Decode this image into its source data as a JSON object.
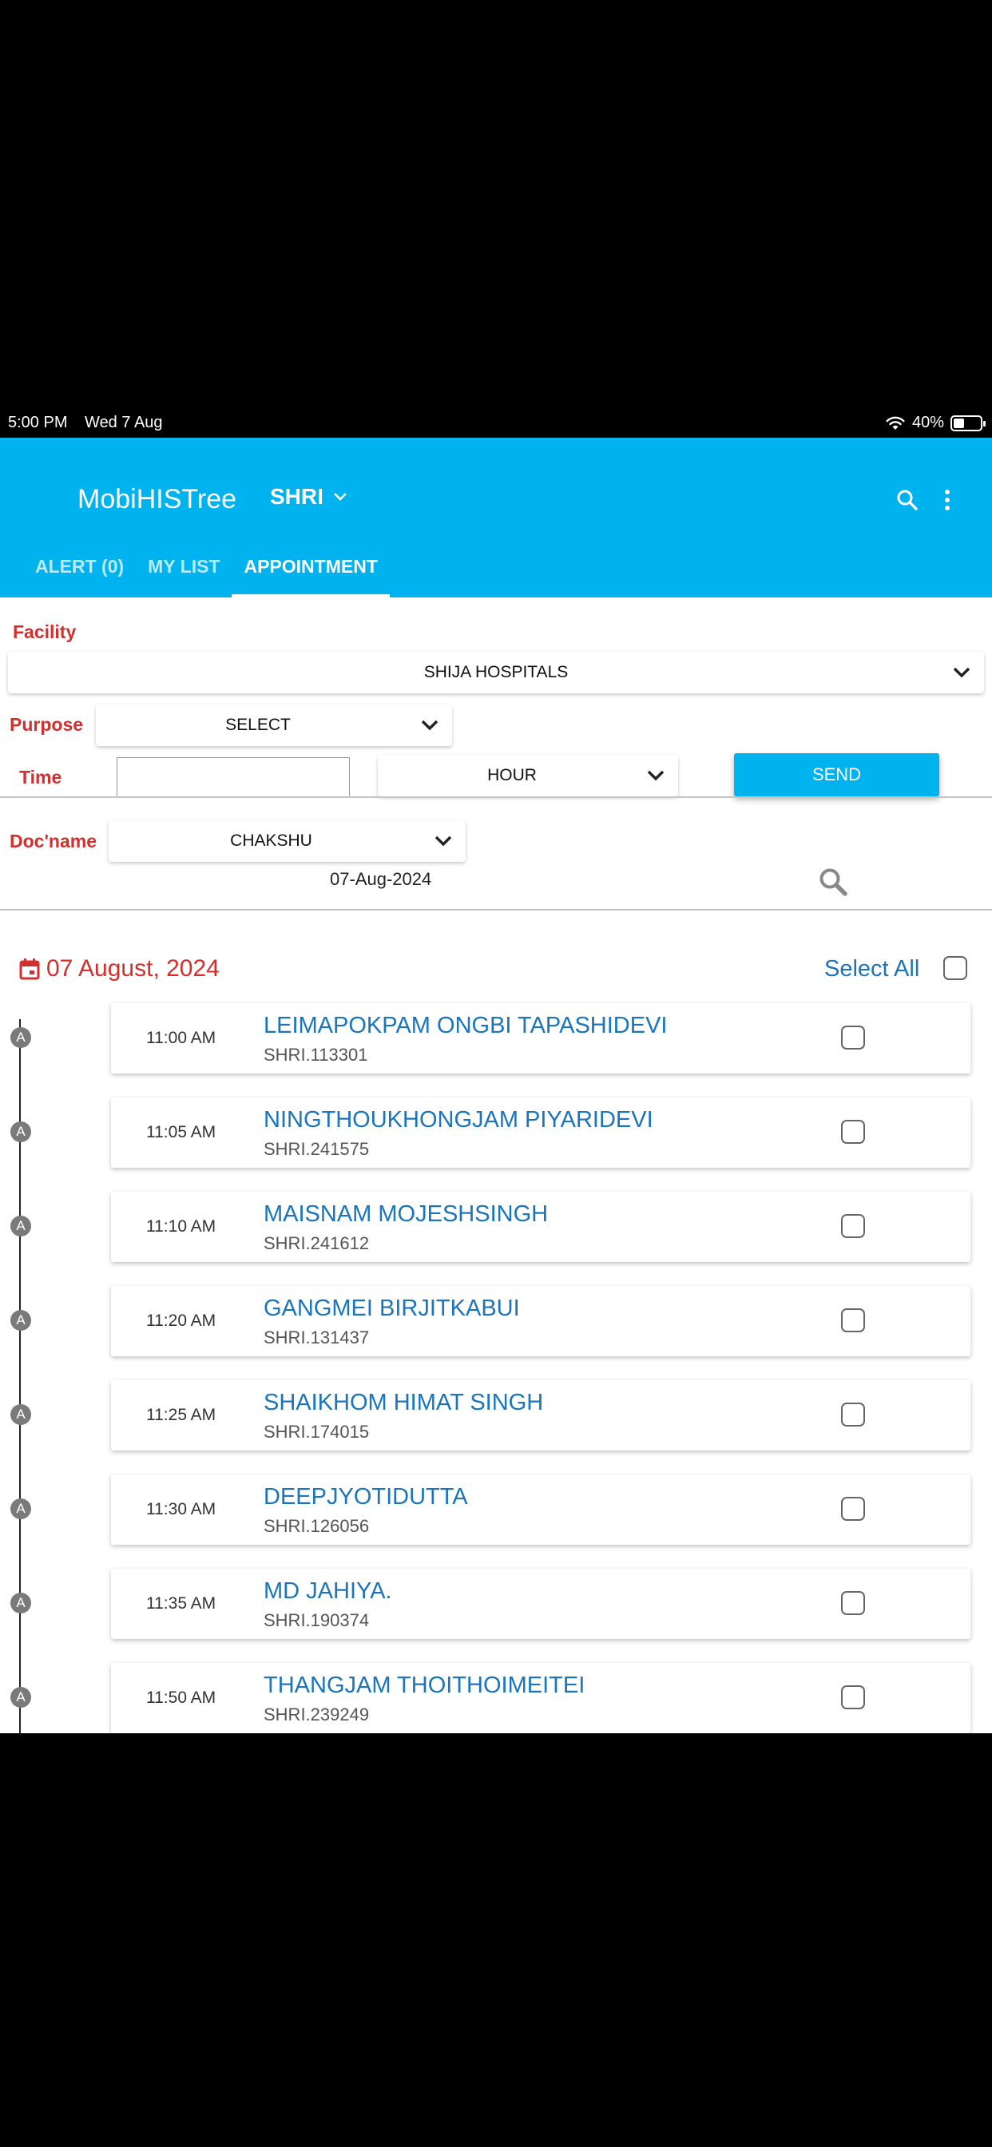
{
  "status_bar": {
    "time": "5:00 PM",
    "date": "Wed 7 Aug",
    "battery": "40%",
    "battery_level": 0.4
  },
  "header": {
    "title": "MobiHISTree",
    "org": "SHRI",
    "tabs": [
      {
        "label": "ALERT (0)",
        "active": false
      },
      {
        "label": "MY LIST",
        "active": false
      },
      {
        "label": "APPOINTMENT",
        "active": true
      }
    ]
  },
  "form": {
    "facility_label": "Facility",
    "facility_value": "SHIJA HOSPITALS",
    "purpose_label": "Purpose",
    "purpose_value": "SELECT",
    "time_label": "Time",
    "time_value": "",
    "hour_value": "HOUR",
    "send_label": "SEND",
    "docname_label": "Doc'name",
    "docname_value": "CHAKSHU",
    "date_value": "07-Aug-2024"
  },
  "list": {
    "date_heading": "07 August, 2024",
    "select_all_label": "Select All",
    "appointments": [
      {
        "badge": "A",
        "time": "11:00 AM",
        "name": "LEIMAPOKPAM ONGBI TAPASHIDEVI",
        "uhid": "SHRI.113301"
      },
      {
        "badge": "A",
        "time": "11:05 AM",
        "name": "NINGTHOUKHONGJAM PIYARIDEVI",
        "uhid": "SHRI.241575"
      },
      {
        "badge": "A",
        "time": "11:10 AM",
        "name": "MAISNAM MOJESHSINGH",
        "uhid": "SHRI.241612"
      },
      {
        "badge": "A",
        "time": "11:20 AM",
        "name": "GANGMEI BIRJITKABUI",
        "uhid": "SHRI.131437"
      },
      {
        "badge": "A",
        "time": "11:25 AM",
        "name": "SHAIKHOM HIMAT SINGH",
        "uhid": "SHRI.174015"
      },
      {
        "badge": "A",
        "time": "11:30 AM",
        "name": "DEEPJYOTIDUTTA",
        "uhid": "SHRI.126056"
      },
      {
        "badge": "A",
        "time": "11:35 AM",
        "name": "MD JAHIYA.",
        "uhid": "SHRI.190374"
      },
      {
        "badge": "A",
        "time": "11:50 AM",
        "name": "THANGJAM THOITHOIMEITEI",
        "uhid": "SHRI.239249"
      }
    ]
  },
  "colors": {
    "primary": "#00b2ee",
    "label_red": "#d32f2f",
    "link_blue": "#1a75bc"
  }
}
